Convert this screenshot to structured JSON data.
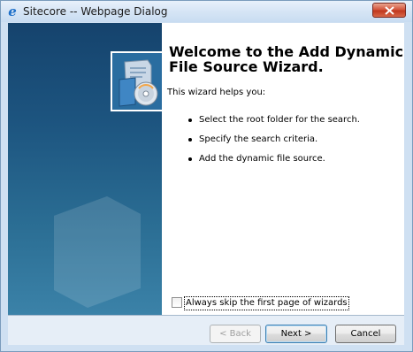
{
  "window": {
    "title": "Sitecore -- Webpage Dialog",
    "app_icon": "ie-icon",
    "close_icon": "close-icon",
    "accent_color": "#c0381e"
  },
  "sidebar": {
    "watermark_icon": "server-watermark-icon",
    "background_color": "#1d5580"
  },
  "main": {
    "logo_icon": "file-cd-wizard-icon",
    "heading": "Welcome to the Add Dynamic File Source Wizard.",
    "intro": "This wizard helps you:",
    "bullets": [
      "Select the root folder for the search.",
      "Specify the search criteria.",
      "Add the dynamic file source."
    ],
    "skip_checkbox": {
      "label": "Always skip the first page of wizards",
      "checked": false
    }
  },
  "footer": {
    "back_label": "< Back",
    "next_label": "Next >",
    "cancel_label": "Cancel"
  }
}
